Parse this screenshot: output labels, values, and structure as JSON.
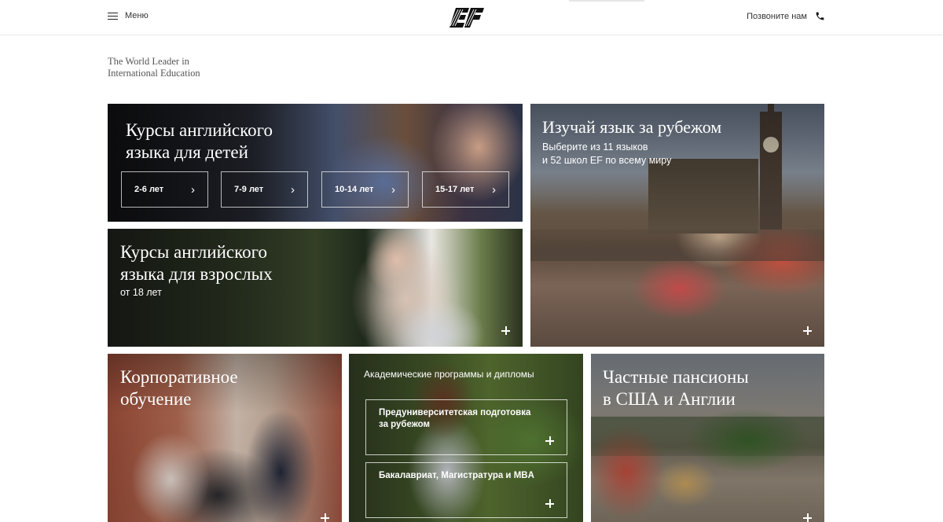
{
  "header": {
    "menu_label": "Меню",
    "logo_text": "EF",
    "call_label": "Позвоните нам"
  },
  "tagline": {
    "line1": "The World Leader in",
    "line2": "International Education"
  },
  "tiles": {
    "kids": {
      "title_line1": "Курсы английского",
      "title_line2": "языка для детей",
      "ages": [
        "2-6 лет",
        "7-9 лет",
        "10-14 лет",
        "15-17 лет"
      ]
    },
    "adults": {
      "title_line1": "Курсы английского",
      "title_line2": "языка для взрослых",
      "subtitle": "от 18 лет"
    },
    "abroad": {
      "title": "Изучай язык за рубежом",
      "subtitle_line1": "Выберите из 11 языков",
      "subtitle_line2": "и 52 школ EF по всему миру"
    },
    "corporate": {
      "title_line1": "Корпоративное",
      "title_line2": "обучение"
    },
    "academic": {
      "title": "Академические программы и дипломы",
      "options": [
        {
          "line1": "Предуниверситетская подготовка",
          "line2": "за рубежом"
        },
        {
          "line1": "Бакалавриат, Магистратура и MBA",
          "line2": ""
        }
      ]
    },
    "boarding": {
      "title_line1": "Частные пансионы",
      "title_line2": "в США и Англии"
    }
  },
  "icons": [
    "hamburger-icon",
    "phone-icon",
    "chevron-right-icon",
    "plus-icon"
  ]
}
